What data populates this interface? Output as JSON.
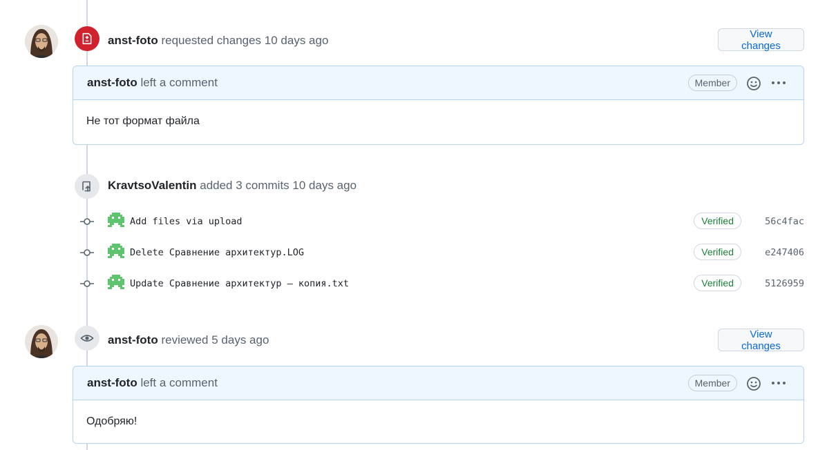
{
  "events": [
    {
      "author": "anst-foto",
      "action": "requested changes",
      "time": "10 days ago",
      "button_label": "View changes",
      "comment": {
        "author": "anst-foto",
        "action": "left a comment",
        "role": "Member",
        "body": "Не тот формат файла"
      }
    },
    {
      "author": "KravtsoValentin",
      "action": "added 3 commits",
      "time": "10 days ago"
    },
    {
      "author": "anst-foto",
      "action": "reviewed",
      "time": "5 days ago",
      "button_label": "View changes",
      "comment": {
        "author": "anst-foto",
        "action": "left a comment",
        "role": "Member",
        "body": "Одобряю!"
      }
    }
  ],
  "commits": [
    {
      "message": "Add files via upload",
      "verified": "Verified",
      "sha": "56c4fac"
    },
    {
      "message": "Delete Сравнение архитектур.LOG",
      "verified": "Verified",
      "sha": "e247406"
    },
    {
      "message": "Update Сравнение архитектур – копия.txt",
      "verified": "Verified",
      "sha": "5126959"
    }
  ],
  "colors": {
    "requested_changes_badge": "#cf222e",
    "link": "#0969da",
    "verified": "#1a7f37",
    "comment_header_bg": "#eef6ff"
  }
}
